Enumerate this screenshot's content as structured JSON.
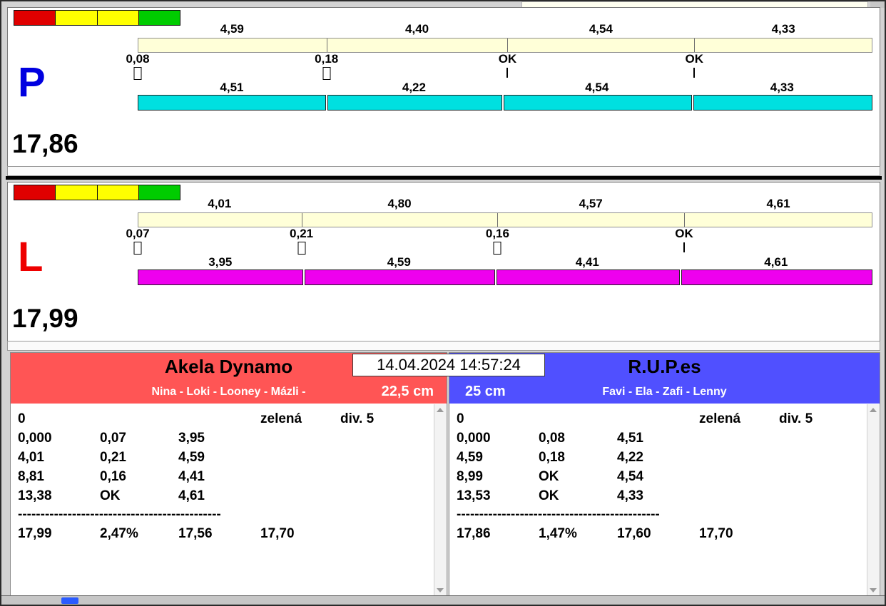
{
  "window": {
    "datetime": "14.04.2024 14:57:24"
  },
  "ui": {
    "taskbar_item_color": "#2a5bff"
  },
  "lanes": [
    {
      "letter": "P",
      "letter_color": "#0000e0",
      "total": "17,86",
      "lights": [
        "#e00000",
        "#ffff00",
        "#ffff00",
        "#00cc00"
      ],
      "top_bar": {
        "color": "#ffffd8",
        "labels": [
          "4,59",
          "4,40",
          "4,54",
          "4,33"
        ],
        "values": [
          4.59,
          4.4,
          4.54,
          4.33
        ]
      },
      "ticks": [
        {
          "label": "0,08",
          "marker": "box"
        },
        {
          "label": "0,18",
          "marker": "box"
        },
        {
          "label": "OK",
          "marker": "line"
        },
        {
          "label": "OK",
          "marker": "line"
        }
      ],
      "bottom_bar": {
        "color": "#00e0e0",
        "labels": [
          "4,51",
          "4,22",
          "4,54",
          "4,33"
        ],
        "values": [
          4.51,
          4.22,
          4.54,
          4.33
        ]
      }
    },
    {
      "letter": "L",
      "letter_color": "#ee0000",
      "total": "17,99",
      "lights": [
        "#e00000",
        "#ffff00",
        "#ffff00",
        "#00cc00"
      ],
      "top_bar": {
        "color": "#ffffd8",
        "labels": [
          "4,01",
          "4,80",
          "4,57",
          "4,61"
        ],
        "values": [
          4.01,
          4.8,
          4.57,
          4.61
        ]
      },
      "ticks": [
        {
          "label": "0,07",
          "marker": "box"
        },
        {
          "label": "0,21",
          "marker": "box"
        },
        {
          "label": "0,16",
          "marker": "box"
        },
        {
          "label": "OK",
          "marker": "line"
        }
      ],
      "bottom_bar": {
        "color": "#ee00ee",
        "labels": [
          "3,95",
          "4,59",
          "4,41",
          "4,61"
        ],
        "values": [
          3.95,
          4.59,
          4.41,
          4.61
        ]
      }
    }
  ],
  "teams": [
    {
      "name": "Akela Dynamo",
      "members": "Nina - Loki - Looney - Mázli -",
      "height": "22,5 cm",
      "color": "#ff5555",
      "log_rows": [
        {
          "cells": [
            "0",
            "",
            "",
            "zelená",
            "div. 5"
          ]
        },
        {
          "cells": [
            "0,000",
            "0,07",
            "3,95",
            "",
            ""
          ]
        },
        {
          "cells": [
            "4,01",
            "0,21",
            "4,59",
            "",
            ""
          ]
        },
        {
          "cells": [
            "8,81",
            "0,16",
            "4,41",
            "",
            ""
          ]
        },
        {
          "cells": [
            "13,38",
            "OK",
            "4,61",
            "",
            ""
          ]
        },
        {
          "separator": "---------------------------------------------"
        },
        {
          "cells": [
            "17,99",
            "2,47%",
            "17,56",
            "17,70",
            ""
          ]
        }
      ]
    },
    {
      "name": "R.U.P.es",
      "members": "Favi - Ela - Zafi - Lenny",
      "height": "25 cm",
      "color": "#5050ff",
      "log_rows": [
        {
          "cells": [
            "0",
            "",
            "",
            "zelená",
            "div. 5"
          ]
        },
        {
          "cells": [
            "0,000",
            "0,08",
            "4,51",
            "",
            ""
          ]
        },
        {
          "cells": [
            "4,59",
            "0,18",
            "4,22",
            "",
            ""
          ]
        },
        {
          "cells": [
            "8,99",
            "OK",
            "4,54",
            "",
            ""
          ]
        },
        {
          "cells": [
            "13,53",
            "OK",
            "4,33",
            "",
            ""
          ]
        },
        {
          "separator": "---------------------------------------------"
        },
        {
          "cells": [
            "17,86",
            "1,47%",
            "17,60",
            "17,70",
            ""
          ]
        }
      ]
    }
  ]
}
